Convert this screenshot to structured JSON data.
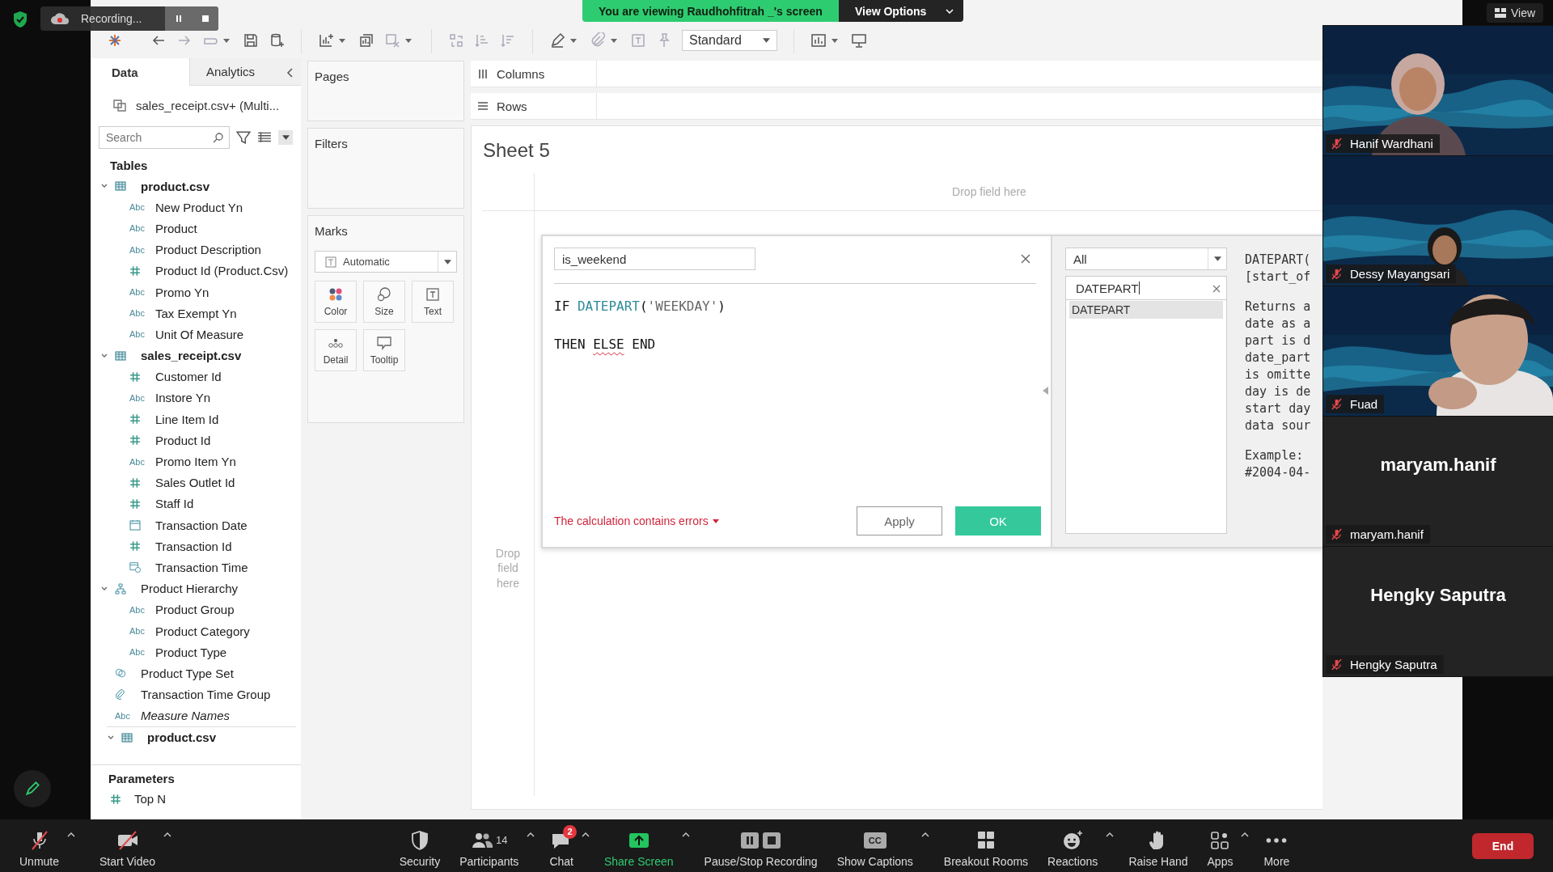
{
  "zoom_overlay": {
    "recording_label": "Recording...",
    "banner": "You are viewing Raudhohfitrah _'s screen",
    "view_options": "View Options",
    "view_button": "View"
  },
  "toolbar": {
    "mark_type": "Standard"
  },
  "data_pane": {
    "tabs": [
      {
        "label": "Data",
        "selected": true
      },
      {
        "label": "Analytics",
        "selected": false
      }
    ],
    "data_source": "sales_receipt.csv+ (Multi...",
    "search": {
      "placeholder": "Search"
    },
    "tables_heading": "Tables",
    "tree": [
      {
        "label": "product.csv",
        "kind": "table",
        "expanded": true,
        "divider": false,
        "children": [
          {
            "label": "New Product Yn",
            "kind": "string",
            "type_label": "Abc"
          },
          {
            "label": "Product",
            "kind": "string",
            "type_label": "Abc"
          },
          {
            "label": "Product Description",
            "kind": "string",
            "type_label": "Abc"
          },
          {
            "label": "Product Id (Product.Csv)",
            "kind": "number"
          },
          {
            "label": "Promo Yn",
            "kind": "string",
            "type_label": "Abc"
          },
          {
            "label": "Tax Exempt Yn",
            "kind": "string",
            "type_label": "Abc"
          },
          {
            "label": "Unit Of Measure",
            "kind": "string",
            "type_label": "Abc"
          }
        ]
      },
      {
        "label": "sales_receipt.csv",
        "kind": "table",
        "expanded": true,
        "divider": false,
        "children": [
          {
            "label": "Customer Id",
            "kind": "number"
          },
          {
            "label": "Instore Yn",
            "kind": "string",
            "type_label": "Abc"
          },
          {
            "label": "Line Item Id",
            "kind": "number"
          },
          {
            "label": "Product Id",
            "kind": "number"
          },
          {
            "label": "Promo Item Yn",
            "kind": "string",
            "type_label": "Abc"
          },
          {
            "label": "Sales Outlet Id",
            "kind": "number"
          },
          {
            "label": "Staff Id",
            "kind": "number"
          },
          {
            "label": "Transaction Date",
            "kind": "date"
          },
          {
            "label": "Transaction Id",
            "kind": "number"
          },
          {
            "label": "Transaction Time",
            "kind": "datetime"
          }
        ]
      },
      {
        "label": "Product Hierarchy",
        "kind": "hierarchy",
        "expanded": true,
        "divider": false,
        "children": [
          {
            "label": "Product Group",
            "kind": "string",
            "type_label": "Abc"
          },
          {
            "label": "Product Category",
            "kind": "string",
            "type_label": "Abc"
          },
          {
            "label": "Product Type",
            "kind": "string",
            "type_label": "Abc"
          }
        ]
      },
      {
        "label": "Product Type Set",
        "kind": "set",
        "divider": false
      },
      {
        "label": "Transaction Time Group",
        "kind": "group",
        "divider": false
      },
      {
        "label": "Measure Names",
        "kind": "measure",
        "type_label": "Abc",
        "divider": false
      },
      {
        "label": "product.csv",
        "kind": "table",
        "expanded": true,
        "divider": true
      }
    ],
    "parameters_heading": "Parameters",
    "parameters": [
      {
        "label": "Top N",
        "kind": "number"
      }
    ]
  },
  "cards": {
    "pages": "Pages",
    "filters": "Filters",
    "marks": "Marks",
    "mark_type": "Automatic",
    "mark_buttons": [
      {
        "label": "Color",
        "kind": "color"
      },
      {
        "label": "Size",
        "kind": "size"
      },
      {
        "label": "Text",
        "kind": "text"
      },
      {
        "label": "Detail",
        "kind": "detail"
      },
      {
        "label": "Tooltip",
        "kind": "tooltip"
      }
    ]
  },
  "shelves": {
    "columns": "Columns",
    "rows": "Rows"
  },
  "sheet": {
    "title": "Sheet 5",
    "drop_top": "Drop field here",
    "drop_left": "Drop field here"
  },
  "calc_dialog": {
    "name": "is_weekend",
    "formula": [
      [
        {
          "text": "IF ",
          "kind": "keyword"
        },
        {
          "text": "DATEPART",
          "kind": "function"
        },
        {
          "text": "(",
          "kind": "keyword"
        },
        {
          "text": "'WEEKDAY'",
          "kind": "string"
        },
        {
          "text": ")",
          "kind": "keyword"
        }
      ],
      [
        {
          "text": "THEN ",
          "kind": "keyword"
        },
        {
          "text": "ELSE",
          "kind": "error"
        },
        {
          "text": " END",
          "kind": "keyword"
        }
      ]
    ],
    "error": "The calculation contains errors",
    "apply": "Apply",
    "ok": "OK",
    "category": "All",
    "function_search": "DATEPART",
    "functions": [
      {
        "label": "DATEPART",
        "selected": true
      }
    ],
    "help_paragraphs": [
      [
        "DATEPART(",
        "[start_of"
      ],
      [
        "Returns a",
        "date as a",
        "part is d",
        "date_part",
        "is omitte",
        "day is de",
        "start day",
        "data sour"
      ],
      [
        "Example:",
        "#2004-04-"
      ]
    ]
  },
  "video_tiles": [
    {
      "name": "Hanif Wardhani",
      "kind": "video",
      "muted": true
    },
    {
      "name": "Dessy Mayangsari",
      "kind": "video",
      "muted": true
    },
    {
      "name": "Fuad",
      "kind": "video",
      "muted": true
    },
    {
      "name": "maryam.hanif",
      "kind": "avatar",
      "muted": true,
      "display_name": "maryam.hanif"
    },
    {
      "name": "Hengky Saputra",
      "kind": "avatar",
      "muted": true,
      "display_name": "Hengky Saputra"
    }
  ],
  "meeting_controls_left": [
    {
      "label": "Unmute",
      "kind": "mic_off",
      "caret": true
    },
    {
      "label": "Start Video",
      "kind": "video_off",
      "caret": true
    }
  ],
  "meeting_controls": [
    {
      "label": "Security",
      "kind": "security",
      "caret": false
    },
    {
      "label": "Participants",
      "kind": "participants",
      "count": "14",
      "caret": true
    },
    {
      "label": "Chat",
      "kind": "chat",
      "badge": "2",
      "caret": true
    },
    {
      "label": "Share Screen",
      "kind": "share",
      "caret": true
    },
    {
      "label": "Pause/Stop Recording",
      "kind": "recording",
      "caret": false
    },
    {
      "label": "Show Captions",
      "kind": "captions",
      "icon_text": "CC",
      "caret": true
    },
    {
      "label": "Breakout Rooms",
      "kind": "breakout",
      "caret": false
    },
    {
      "label": "Reactions",
      "kind": "reactions",
      "caret": true
    },
    {
      "label": "Raise Hand",
      "kind": "hand",
      "caret": false
    },
    {
      "label": "Apps",
      "kind": "apps",
      "caret": true
    },
    {
      "label": "More",
      "kind": "more",
      "caret": false
    }
  ],
  "end_button": "End"
}
